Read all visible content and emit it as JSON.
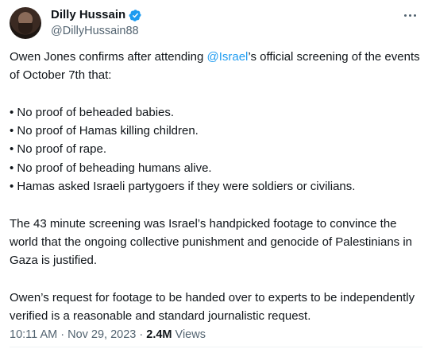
{
  "author": {
    "name": "Dilly Hussain",
    "handle": "@DillyHussain88",
    "verified": true
  },
  "tweet": {
    "line1_pre": "Owen Jones confirms after attending ",
    "mention": "@Israel",
    "line1_post": "’s official screening of the events of October 7th that:",
    "bullets": [
      "• No proof of beheaded babies.",
      "• No proof of Hamas killing children.",
      "• No proof of rape.",
      "• No proof of beheading humans alive.",
      "• Hamas asked Israeli partygoers if they were soldiers or civilians."
    ],
    "para2": "The 43 minute screening was Israel’s handpicked footage to convince the world that the ongoing collective punishment and genocide of Palestinians in Gaza is justified.",
    "para3": "Owen’s request for footage to be handed over to experts to be independently verified is a reasonable and standard journalistic request."
  },
  "meta": {
    "time": "10:11 AM",
    "sep1": " · ",
    "date": "Nov 29, 2023",
    "sep2": " · ",
    "views_count": "2.4M",
    "views_label": " Views"
  },
  "colors": {
    "link": "#1d9bf0",
    "secondary": "#536471",
    "text": "#0f1419"
  },
  "icons": [
    "verified-badge-icon",
    "more-options-icon"
  ]
}
